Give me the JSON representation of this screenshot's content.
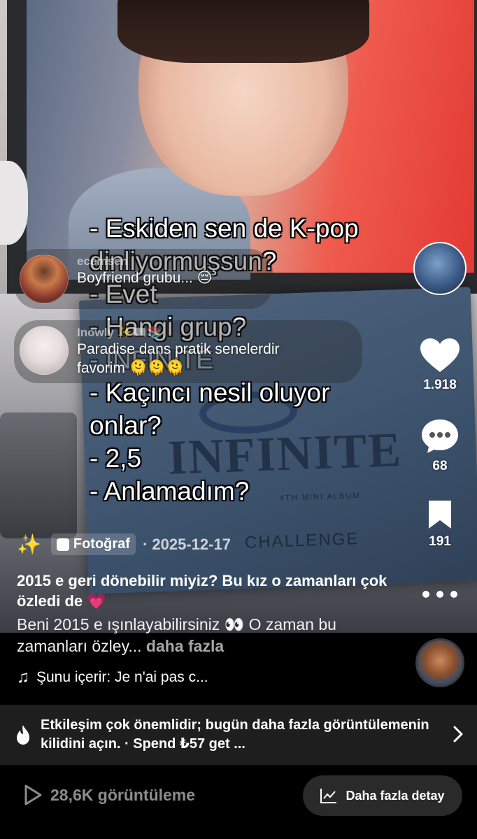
{
  "overlay_lines": [
    "- Eskiden sen de K-pop",
    "dinliyormuşsun?",
    "- Evet",
    "- Hangi grup?",
    "- INFINITE",
    "- Kaçıncı nesil oluyor",
    "onlar?",
    "- 2,5",
    "- Anlamadım?"
  ],
  "album": {
    "title": "INFINITE",
    "subtitle": "4TH MINI ALBUM",
    "tagline": "CHALLENGE"
  },
  "comments": [
    {
      "user": "ecemsen",
      "text": "Boyfriend grubu... 😔"
    },
    {
      "user": "Inowly ✨📖📚",
      "text_line1": "Paradise dans pratik senelerdir",
      "text_line2": "favorim 🫠🫠🫠"
    }
  ],
  "rail": {
    "likes": "1.918",
    "comments": "68",
    "saves": "191"
  },
  "meta": {
    "sparkle": "✨",
    "type_label": "Fotoğraf",
    "date": "· 2025-12-17"
  },
  "caption": {
    "title": "2015 e geri dönebilir miyiz? Bu kız o zamanları çok özledi de 💗",
    "desc": "Beni 2015 e ışınlayabilirsiniz 👀 O zaman bu zamanları özley...",
    "more": "daha fazla"
  },
  "music": {
    "label": "Şunu içerir: Je n'ai pas c..."
  },
  "promo": {
    "text": "Etkileşim çok önemlidir; bugün daha fazla görüntülemenin kilidini açın. · Spend ₺57 get ..."
  },
  "bottom": {
    "views": "28,6K görüntüleme",
    "detail_button": "Daha fazla detay"
  },
  "colors": {
    "accent_pink": "#ff3b6b",
    "banner_bg": "#1e1e1e",
    "button_bg": "#2a2a2a"
  }
}
